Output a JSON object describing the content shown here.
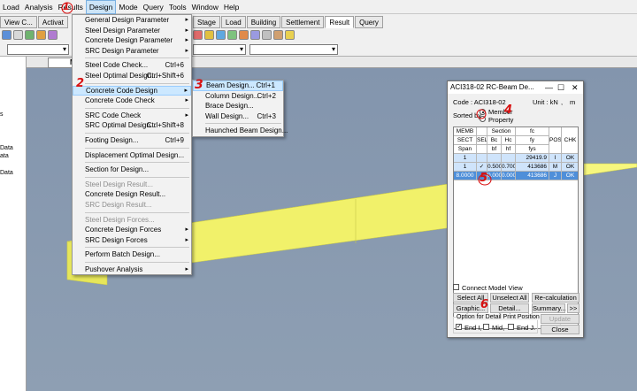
{
  "menubar": {
    "items": [
      "Load",
      "Analysis",
      "Results",
      "Design",
      "Mode",
      "Query",
      "Tools",
      "Window",
      "Help"
    ]
  },
  "toolbar": {
    "left_tabs": [
      "View C...",
      "Activat"
    ],
    "right_tabs": [
      "Stage",
      "Load",
      "Building",
      "Settlement",
      "Result",
      "Query"
    ]
  },
  "left_panel": {
    "lines": [
      "s",
      "Data",
      "ata",
      "Data"
    ]
  },
  "viewport": {
    "tab_label": "Mode"
  },
  "design_menu": {
    "items": [
      {
        "label": "General Design Parameter",
        "arrow": "▸"
      },
      {
        "label": "Steel Design Parameter",
        "arrow": "▸"
      },
      {
        "label": "Concrete Design Parameter",
        "arrow": "▸"
      },
      {
        "label": "SRC Design Parameter",
        "arrow": "▸"
      },
      {
        "sep": true
      },
      {
        "label": "Steel Code Check...",
        "shortcut": "Ctrl+6"
      },
      {
        "label": "Steel Optimal Design...",
        "shortcut": "Ctrl+Shift+6"
      },
      {
        "sep": true
      },
      {
        "label": "Concrete Code Design",
        "arrow": "▸",
        "highlighted": true
      },
      {
        "label": "Concrete Code Check",
        "arrow": "▸"
      },
      {
        "sep": true
      },
      {
        "label": "SRC Code Check",
        "arrow": "▸"
      },
      {
        "label": "SRC Optimal Design...",
        "shortcut": "Ctrl+Shift+8"
      },
      {
        "sep": true
      },
      {
        "label": "Footing Design...",
        "shortcut": "Ctrl+9"
      },
      {
        "sep": true
      },
      {
        "label": "Displacement Optimal Design..."
      },
      {
        "sep": true
      },
      {
        "label": "Section for Design..."
      },
      {
        "sep": true
      },
      {
        "label": "Steel Design Result...",
        "disabled": true
      },
      {
        "label": "Concrete Design Result..."
      },
      {
        "label": "SRC Design Result...",
        "disabled": true
      },
      {
        "sep": true
      },
      {
        "label": "Steel Design Forces...",
        "disabled": true
      },
      {
        "label": "Concrete Design Forces",
        "arrow": "▸"
      },
      {
        "label": "SRC Design Forces",
        "arrow": "▸"
      },
      {
        "sep": true
      },
      {
        "label": "Perform Batch Design..."
      },
      {
        "sep": true
      },
      {
        "label": "Pushover Analysis",
        "arrow": "▸"
      }
    ]
  },
  "submenu": {
    "items": [
      {
        "label": "Beam Design...",
        "shortcut": "Ctrl+1",
        "highlighted": true
      },
      {
        "label": "Column Design...",
        "shortcut": "Ctrl+2"
      },
      {
        "label": "Brace Design..."
      },
      {
        "label": "Wall Design...",
        "shortcut": "Ctrl+3"
      },
      {
        "sep": true
      },
      {
        "label": "Haunched Beam Design..."
      }
    ]
  },
  "dialog": {
    "title": "ACI318-02 RC-Beam De...",
    "controls": {
      "min": "—",
      "max": "☐",
      "close": "✕"
    },
    "code_label": "Code : ACI318-02",
    "unit_label": "Unit : kN",
    "unit_sep": ",",
    "unit_value": "m",
    "sorted_by": "Sorted by",
    "sort_member": "Member",
    "sort_property": "Property",
    "table": {
      "header1": [
        "MEMB",
        "Section",
        "fc"
      ],
      "header2": [
        "SECT",
        "SEL",
        "Bc",
        "Hc",
        "fy",
        "POS",
        "CHK"
      ],
      "header3": [
        "Span",
        "bf",
        "hf",
        "fys"
      ],
      "rows": [
        {
          "memb": "1",
          "sel": "",
          "bc": "",
          "hc": "",
          "f": "29419.9",
          "pos": "I",
          "chk": "OK"
        },
        {
          "memb": "1",
          "sel": "✓",
          "bc": "0.500",
          "hc": "0.700",
          "f": "413686",
          "pos": "M",
          "chk": "OK"
        },
        {
          "memb": "8.0000",
          "sel": "",
          "bc": "0.000",
          "hc": "0.000",
          "f": "413686",
          "pos": "J",
          "chk": "OK"
        }
      ]
    },
    "connect_model_view": "Connect Model View",
    "buttons": {
      "select_all": "Select All",
      "unselect_all": "Unselect All",
      "recalc": "Re-calculation",
      "graphic": "Graphic...",
      "detail": "Detail...",
      "summary": "Summary...",
      "more": ">>",
      "update_rebar": "Update Rebar",
      "close": "Close"
    },
    "option_title": "Option for Detail Print Position",
    "options": [
      "End I,",
      "Mid,",
      "End J."
    ]
  },
  "annotations": [
    "1",
    "2",
    "3",
    "4",
    "5",
    "6"
  ],
  "colors": {
    "beam_face": "#f3f36b",
    "beam_top": "#f7f77e",
    "beam_side": "#e8e85c",
    "viewport_bg": "#8a9bb1",
    "annotation": "#d81111",
    "highlight": "#cce8ff"
  }
}
